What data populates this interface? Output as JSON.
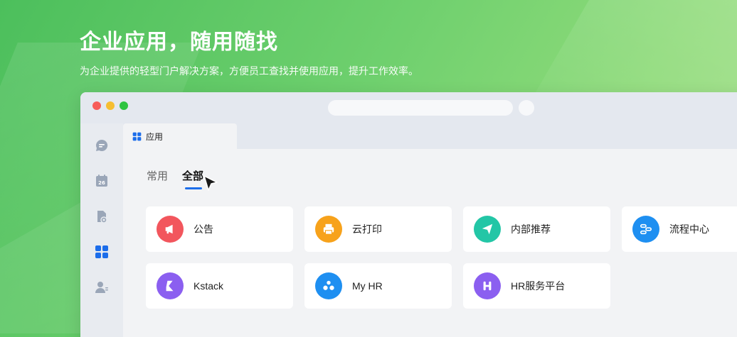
{
  "hero": {
    "title": "企业应用，随用随找",
    "subtitle": "为企业提供的轻型门户解决方案，方便员工查找并使用应用，提升工作效率。"
  },
  "window": {
    "tab_label": "应用",
    "subtabs": {
      "common": "常用",
      "all": "全部"
    },
    "active_subtab": "全部"
  },
  "sidebar": {
    "items": [
      {
        "icon": "chat-icon"
      },
      {
        "icon": "calendar-icon",
        "badge": "26"
      },
      {
        "icon": "document-icon"
      },
      {
        "icon": "apps-grid-icon",
        "active": true
      },
      {
        "icon": "contacts-icon"
      }
    ]
  },
  "apps": [
    {
      "name": "公告",
      "icon": "megaphone-icon",
      "color": "#f2565d"
    },
    {
      "name": "云打印",
      "icon": "printer-icon",
      "color": "#f7a21b"
    },
    {
      "name": "内部推荐",
      "icon": "paper-plane-icon",
      "color": "#23c6a6"
    },
    {
      "name": "流程中心",
      "icon": "workflow-icon",
      "color": "#1e8ff1"
    },
    {
      "name": "Kstack",
      "icon": "kstack-icon",
      "color": "#8b5ff0"
    },
    {
      "name": "My HR",
      "icon": "people-icon",
      "color": "#1e8ff1"
    },
    {
      "name": "HR服务平台",
      "icon": "hr-platform-icon",
      "color": "#8b5ff0"
    }
  ],
  "colors": {
    "accent": "#1c6dea",
    "background_green": "#5ec866"
  }
}
